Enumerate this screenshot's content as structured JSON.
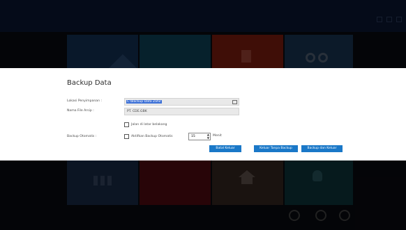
{
  "window": {
    "title": "",
    "subtitle": ""
  },
  "dialog": {
    "title": "Backup Data",
    "fields": {
      "lokasi_label": "Lokasi Penyimpanan :",
      "lokasi_value": "C:\\Backup Data Zahir",
      "nama_label": "Nama File Arsip :",
      "nama_value": "PT. CDE.GBK",
      "jalan_label": "Jalan di latar belakang",
      "otomatis_label": "Backup Otomatis :",
      "aktifkan_label": "Aktifkan Backup Otomatis",
      "interval_value": "15",
      "interval_unit": "Menit"
    },
    "buttons": {
      "batal": "Batal Keluar",
      "keluar_tanpa": "Keluar Tanpa Backup",
      "backup_keluar": "Backup dan Keluar"
    }
  },
  "colors": {
    "accent": "#1a78c8",
    "selection": "#3b6fd6",
    "titlebar": "#0c1a38"
  },
  "icons": [
    "search-icon",
    "phone-icon",
    "close-icon",
    "folder-icon",
    "home-icon",
    "gear-icon"
  ]
}
